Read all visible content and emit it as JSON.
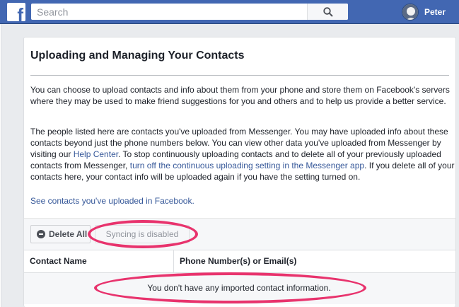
{
  "header": {
    "logo_glyph": "f",
    "search_placeholder": "Search",
    "search_icon": "search-icon",
    "user_name": "Peter"
  },
  "page": {
    "title": "Uploading and Managing Your Contacts",
    "para1": "You can choose to upload contacts and info about them from your phone and store them on Facebook's servers where they may be used to make friend suggestions for you and others and to help us provide a better service.",
    "para2_a": "The people listed here are contacts you've uploaded from Messenger. You may have uploaded info about these contacts beyond just the phone numbers below. You can view other data you've uploaded from Messenger by visiting our ",
    "help_center_link": "Help Center",
    "para2_b": ". To stop continuously uploading contacts and to delete all of your previously uploaded contacts from Messenger, ",
    "turn_off_link": "turn off the continuous uploading setting in the Messenger app",
    "para2_c": ". If you delete all of your contacts here, your contact info will be uploaded again if you have the setting turned on.",
    "see_contacts_link": "See contacts you've uploaded in Facebook."
  },
  "toolbar": {
    "delete_all_label": "Delete All",
    "syncing_label": "Syncing is disabled"
  },
  "table": {
    "columns": [
      "Contact Name",
      "Phone Number(s) or Email(s)"
    ],
    "empty_message": "You don't have any imported contact information."
  },
  "colors": {
    "brand": "#4267b2",
    "link": "#365899",
    "annotation": "#e8336d"
  }
}
